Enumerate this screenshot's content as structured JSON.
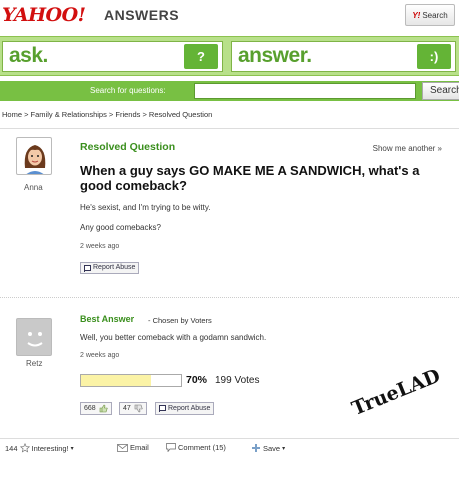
{
  "header": {
    "logo_text": "YAHOO!",
    "logo_sub": "ANSWERS",
    "search_button_label": "Search",
    "search_button_logo": "Y!"
  },
  "askbar": {
    "ask_label": "ask.",
    "answer_label": "answer.",
    "ask_icon": "?",
    "answer_icon": ":)"
  },
  "searchbar": {
    "label": "Search for questions:",
    "input_value": "",
    "button_label": "Search"
  },
  "breadcrumb": "Home > Family & Relationships > Friends > Resolved Question",
  "question": {
    "section_title": "Resolved Question",
    "show_another": "Show me another »",
    "asker": "Anna",
    "title": "When a guy says GO MAKE ME A SANDWICH, what's a good comeback?",
    "details_1": "He's sexist, and I'm trying to be witty.",
    "details_2": "Any good comebacks?",
    "time": "2 weeks ago",
    "report_label": "Report Abuse"
  },
  "best_answer": {
    "title": "Best Answer",
    "chosen_by": "- Chosen by Voters",
    "answerer": "Retz",
    "text": "Well, you better comeback with a godamn sandwich.",
    "time": "2 weeks ago",
    "vote_percent_label": "70%",
    "vote_fraction": 0.7,
    "vote_count": "199 Votes",
    "thumbs_up": "668",
    "thumbs_down": "47",
    "report_label": "Report Abuse"
  },
  "bottom_bar": {
    "interesting_count": "144",
    "interesting_label": "Interesting!",
    "email_label": "Email",
    "comment_label": "Comment (15)",
    "save_label": "Save"
  },
  "watermark": "TrueLAD",
  "colors": {
    "brand_red": "#d20f0f",
    "accent_green": "#58a02e",
    "bar_green": "#78c043",
    "vote_fill": "#fbf3a6"
  }
}
